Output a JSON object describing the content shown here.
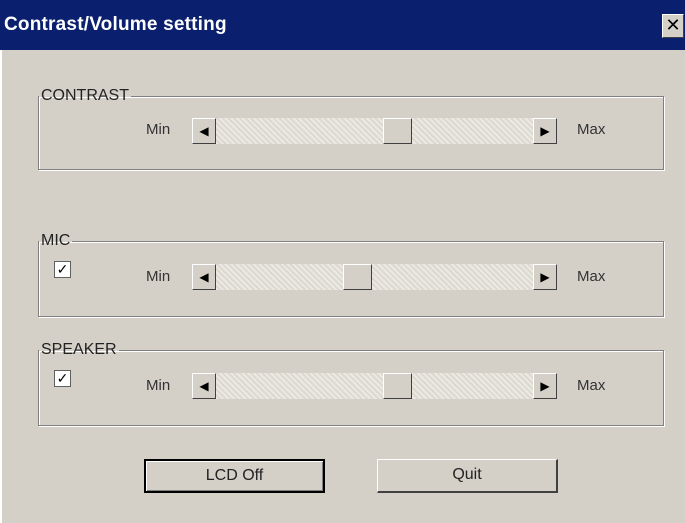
{
  "window": {
    "title": "Contrast/Volume setting",
    "close_glyph": "✕"
  },
  "contrast": {
    "legend": "CONTRAST",
    "min_label": "Min",
    "max_label": "Max",
    "value_fraction": 0.58
  },
  "mic": {
    "legend": "MIC",
    "checked": true,
    "min_label": "Min",
    "max_label": "Max",
    "value_fraction": 0.44
  },
  "speaker": {
    "legend": "SPEAKER",
    "checked": true,
    "min_label": "Min",
    "max_label": "Max",
    "value_fraction": 0.58
  },
  "buttons": {
    "lcd_off": "LCD Off",
    "quit": "Quit"
  },
  "glyphs": {
    "left_arrow": "◀",
    "right_arrow": "▶",
    "check": "✓"
  }
}
